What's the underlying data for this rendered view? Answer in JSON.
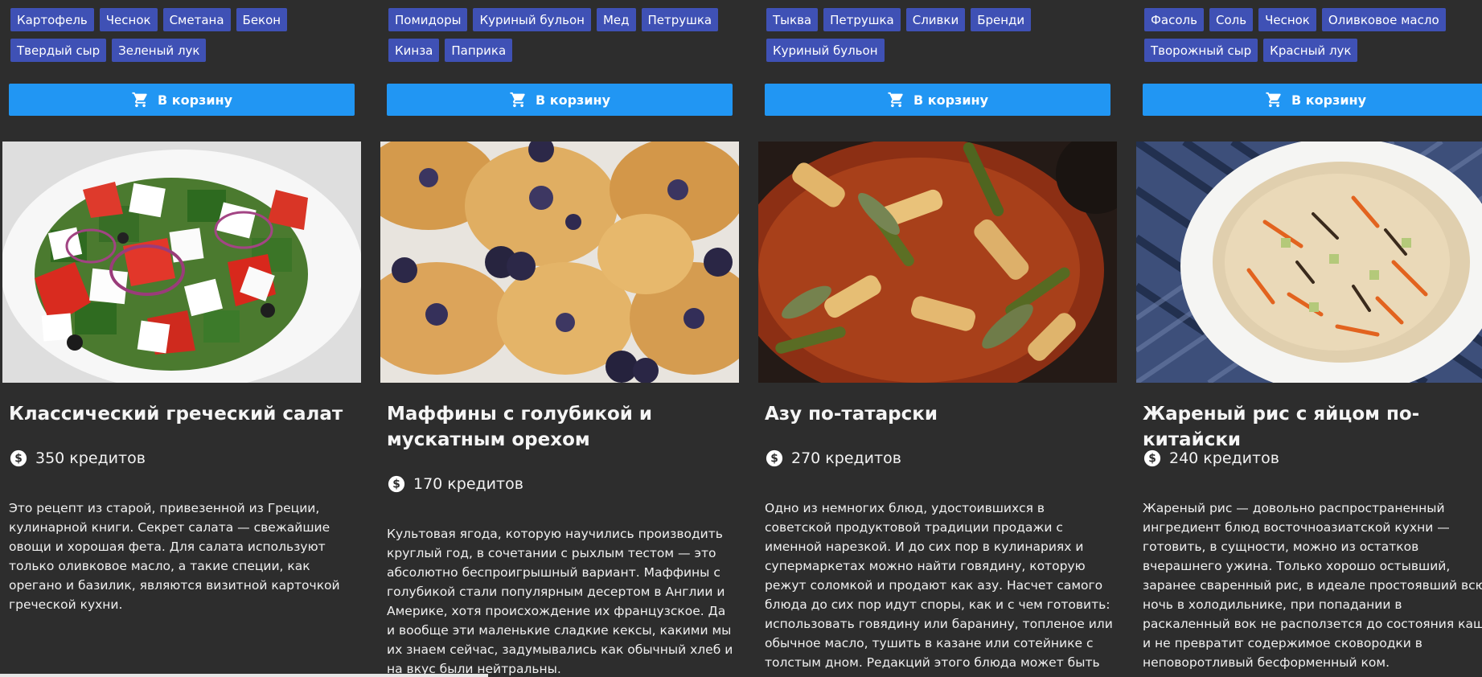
{
  "cart_button_label": "В корзину",
  "colors": {
    "background": "#2d2d2d",
    "tag": "#3f51b5",
    "cart_button": "#2196f3",
    "text": "#f2f2f2"
  },
  "icons": {
    "cart": "shopping-cart-icon",
    "price": "dollar-circle-icon"
  },
  "recipes": [
    {
      "tags": [
        "Картофель",
        "Чеснок",
        "Сметана",
        "Бекон",
        "Твердый сыр",
        "Зеленый лук"
      ],
      "title": "Классический греческий салат",
      "price": "350 кредитов",
      "description": "Это рецепт из старой, привезенной из Греции, кулинарной книги. Секрет салата — свежайшие овощи и хорошая фета. Для салата используют только оливковое масло, а такие специи, как орегано и базилик, являются визитной карточкой греческой кухни."
    },
    {
      "tags": [
        "Помидоры",
        "Куриный бульон",
        "Мед",
        "Петрушка",
        "Кинза",
        "Паприка"
      ],
      "title": "Маффины с голубикой и мускатным орехом",
      "price": "170 кредитов",
      "description": "Культовая ягода, которую научились производить круглый год, в сочетании с рыхлым тестом — это абсолютно беспроигрышный вариант. Маффины с голубикой стали популярным десертом в Англии и Америке, хотя происхождение их французское. Да и вообще эти маленькие сладкие кексы, какими мы их знаем сейчас, задумывались как обычный хлеб и на вкус были нейтральны."
    },
    {
      "tags": [
        "Тыква",
        "Петрушка",
        "Сливки",
        "Бренди",
        "Куриный бульон"
      ],
      "title": "Азу по-татарски",
      "price": "270 кредитов",
      "description": "Одно из немногих блюд, удостоившихся в советской продуктовой традиции продажи с именной нарезкой. И до сих пор в кулинариях и супермаркетах можно найти говядину, которую режут соломкой и продают как азу. Насчет самого блюда до сих пор идут споры, как и с чем готовить: использовать говядину или баранину, топленое или обычное масло, тушить в казане или сотейнике с толстым дном. Редакций этого блюда может быть много, но основа его всегда неизменна — это нарезанное"
    },
    {
      "tags": [
        "Фасоль",
        "Соль",
        "Чеснок",
        "Оливковое масло",
        "Творожный сыр",
        "Красный лук"
      ],
      "title": "Жареный рис с яйцом по-китайски",
      "price": "240 кредитов",
      "description": "Жареный рис — довольно распространенный ингредиент блюд восточноазиатской кухни — готовить, в сущности, можно из остатков вчерашнего ужина. Только хорошо остывший, заранее сваренный рис, в идеале простоявший всю ночь в холодильнике, при попадании в раскаленный вок не расползется до состояния каши и не превратит содержимое сковородки в неповоротливый бесформенный ком."
    }
  ]
}
